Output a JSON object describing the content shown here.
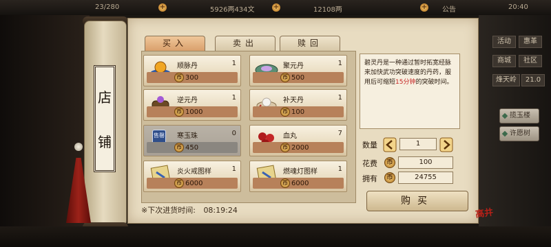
{
  "hud": {
    "stamina": "23/280",
    "silver": "5926两434文",
    "gold": "12108两",
    "announce": "公告",
    "clock": "20:40"
  },
  "right_menu": {
    "btn_activity": "活动",
    "btn_city": "惠革",
    "btn_shop": "商城",
    "btn_guild": "社区",
    "days": "烽天岭",
    "level": "21.0",
    "jade_hall": "揽玉楼",
    "wish_tree": "许愿树"
  },
  "shop_title": [
    "店",
    "铺"
  ],
  "tabs": [
    "买入",
    "卖出",
    "赎回"
  ],
  "active_tab": 0,
  "items": [
    {
      "name": "顺脉丹",
      "count": "1",
      "price": "300",
      "icon": "gold-pill-bowl-icon"
    },
    {
      "name": "聚元丹",
      "count": "1",
      "price": "500",
      "icon": "jade-dish-icon"
    },
    {
      "name": "逆元丹",
      "count": "1",
      "price": "1000",
      "icon": "purple-pot-icon"
    },
    {
      "name": "补天丹",
      "count": "1",
      "price": "100",
      "icon": "white-pill-icon"
    },
    {
      "name": "寒玉珠",
      "count": "0",
      "price": "450",
      "icon": "sold-out-icon",
      "sold_label": "售罄"
    },
    {
      "name": "血丸",
      "count": "7",
      "price": "2000",
      "icon": "red-pills-icon"
    },
    {
      "name": "炎火戒图样",
      "count": "1",
      "price": "6000",
      "icon": "scroll-blueprint-icon"
    },
    {
      "name": "燃魂灯图样",
      "count": "1",
      "price": "6000",
      "icon": "scroll-blueprint-icon"
    }
  ],
  "description": {
    "text_pre": "碧灵丹是一种通过暂时拓宽经脉来加快武功突破速度的丹药，服用后可缩短",
    "highlight": "15分钟",
    "text_post": "的突破时间。"
  },
  "quantity": {
    "label": "数量",
    "value": "1"
  },
  "cost": {
    "label": "花费",
    "value": "100"
  },
  "owned": {
    "label": "拥有",
    "value": "24755"
  },
  "buy_button": "购买",
  "restock": {
    "label": "※下次进货时间:",
    "time": "08:19:24"
  },
  "seal_text": "高井",
  "colors": {
    "active_tab": "#d9a06c",
    "price_bar": "#b7815a",
    "highlight": "#c41f1f"
  }
}
